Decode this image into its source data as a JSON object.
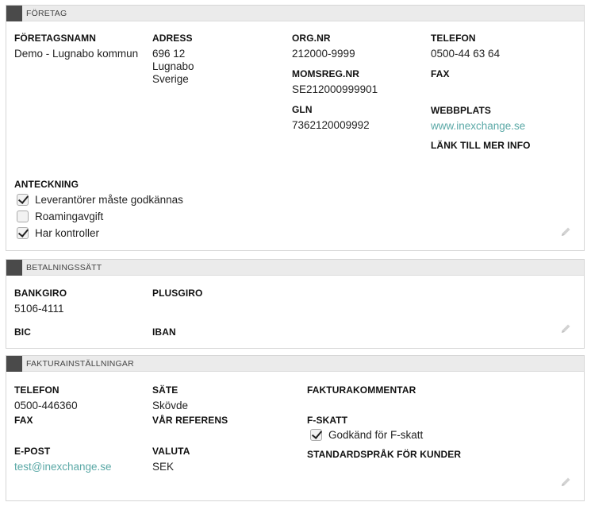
{
  "company": {
    "header": "Företag",
    "name_label": "Företagsnamn",
    "name_value": "Demo - Lugnabo kommun",
    "address_label": "Adress",
    "address_lines": [
      "696 12",
      "Lugnabo",
      "Sverige"
    ],
    "orgnr_label": "Org.nr",
    "orgnr_value": "212000-9999",
    "vat_label": "Momsreg.nr",
    "vat_value": "SE212000999901",
    "gln_label": "GLN",
    "gln_value": "7362120009992",
    "phone_label": "Telefon",
    "phone_value": "0500-44 63 64",
    "fax_label": "Fax",
    "website_label": "Webbplats",
    "website_value": "www.inexchange.se",
    "more_info_label": "Länk till mer info",
    "note_label": "Anteckning",
    "checkboxes": [
      {
        "label": "Leverantörer måste godkännas",
        "checked": true
      },
      {
        "label": "Roamingavgift",
        "checked": false
      },
      {
        "label": "Har kontroller",
        "checked": true
      }
    ]
  },
  "payment": {
    "header": "Betalningssätt",
    "bankgiro_label": "Bankgiro",
    "bankgiro_value": "5106-4111",
    "plusgiro_label": "Plusgiro",
    "bic_label": "BIC",
    "iban_label": "IBAN"
  },
  "invoice": {
    "header": "Fakturainställningar",
    "phone_label": "Telefon",
    "phone_value": "0500-446360",
    "seat_label": "Säte",
    "seat_value": "Skövde",
    "comment_label": "Fakturakommentar",
    "fax_label": "Fax",
    "reference_label": "Vår referens",
    "ftax_label": "F-skatt",
    "ftax_checkbox": {
      "label": "Godkänd för F-skatt",
      "checked": true
    },
    "email_label": "E-post",
    "email_value": "test@inexchange.se",
    "currency_label": "Valuta",
    "currency_value": "SEK",
    "language_label": "Standardspråk för kunder"
  },
  "colors": {
    "link": "#5aa8a6",
    "header_marker": "#4a4a4a"
  }
}
